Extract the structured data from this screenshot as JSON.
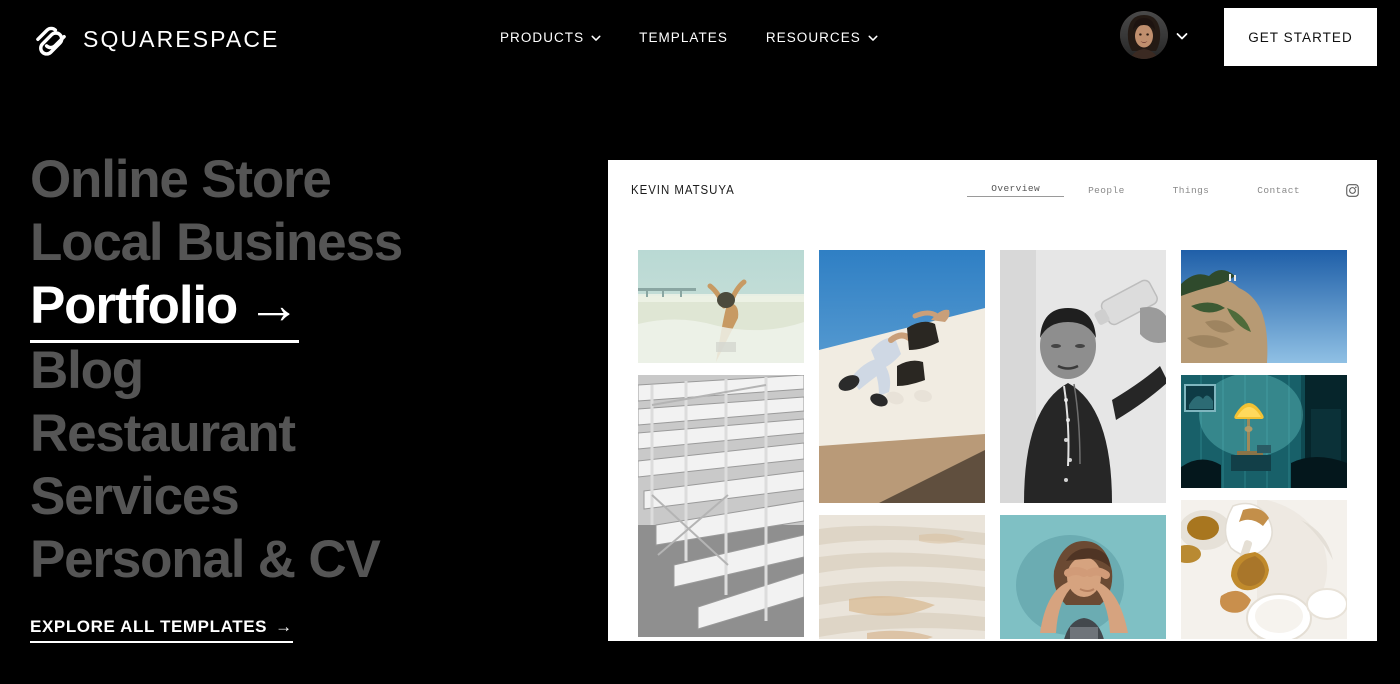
{
  "brand": {
    "name": "SQUARESPACE",
    "logo_icon": "squarespace-logo-icon"
  },
  "topnav": {
    "links": [
      {
        "label": "PRODUCTS",
        "has_chevron": true
      },
      {
        "label": "TEMPLATES",
        "has_chevron": false
      },
      {
        "label": "RESOURCES",
        "has_chevron": true
      }
    ],
    "account": {
      "avatar_icon": "user-avatar",
      "chevron_icon": "chevron-down-icon"
    },
    "cta": {
      "label": "GET STARTED"
    }
  },
  "categories": {
    "items": [
      {
        "label": "Online Store",
        "active": false
      },
      {
        "label": "Local Business",
        "active": false
      },
      {
        "label": "Portfolio",
        "active": true,
        "arrow": "→"
      },
      {
        "label": "Blog",
        "active": false
      },
      {
        "label": "Restaurant",
        "active": false
      },
      {
        "label": "Services",
        "active": false
      },
      {
        "label": "Personal & CV",
        "active": false
      }
    ],
    "explore": {
      "label": "EXPLORE ALL TEMPLATES",
      "arrow": "→"
    }
  },
  "preview": {
    "site_title": "KEVIN MATSUYA",
    "nav": [
      {
        "label": "Overview",
        "active": true
      },
      {
        "label": "People",
        "active": false
      },
      {
        "label": "Things",
        "active": false
      },
      {
        "label": "Contact",
        "active": false
      }
    ],
    "social_icon": "instagram-icon",
    "gallery": [
      {
        "id": "beach-surf-woman",
        "col": 1,
        "aspect": "landscape"
      },
      {
        "id": "bleachers-bw",
        "col": 1,
        "aspect": "portrait"
      },
      {
        "id": "two-people-white-wall",
        "col": 2,
        "aspect": "portrait"
      },
      {
        "id": "travertine-steps",
        "col": 2,
        "aspect": "portrait"
      },
      {
        "id": "man-water-bottle-bw",
        "col": 3,
        "aspect": "portrait"
      },
      {
        "id": "woman-teal-backdrop",
        "col": 3,
        "aspect": "portrait"
      },
      {
        "id": "cliff-blue-sky",
        "col": 4,
        "aspect": "landscape"
      },
      {
        "id": "yellow-lamp-teal-room",
        "col": 4,
        "aspect": "landscape"
      },
      {
        "id": "tea-pouring-overhead",
        "col": 4,
        "aspect": "landscape"
      }
    ]
  },
  "colors": {
    "background": "#000000",
    "text_inactive": "#555555",
    "text_active": "#ffffff",
    "panel": "#ffffff",
    "cta_bg": "#ffffff"
  }
}
